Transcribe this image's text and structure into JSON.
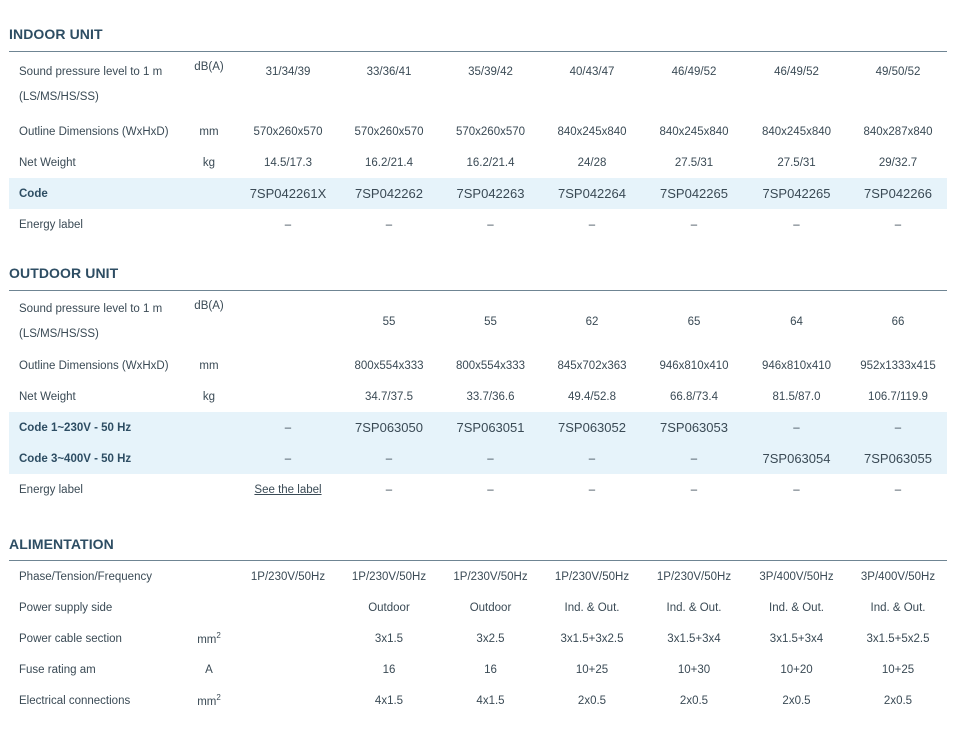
{
  "indoor": {
    "title": "INDOOR UNIT",
    "rows": [
      {
        "label_line1": "Sound pressure level to 1 m",
        "label_line2": "(LS/MS/HS/SS)",
        "unit": "dB(A)",
        "values": [
          "31/34/39",
          "33/36/41",
          "35/39/42",
          "40/43/47",
          "46/49/52",
          "46/49/52",
          "49/50/52"
        ]
      },
      {
        "label": "Outline Dimensions (WxHxD)",
        "unit": "mm",
        "values": [
          "570x260x570",
          "570x260x570",
          "570x260x570",
          "840x245x840",
          "840x245x840",
          "840x245x840",
          "840x287x840"
        ]
      },
      {
        "label": "Net Weight",
        "unit": "kg",
        "values": [
          "14.5/17.3",
          "16.2/21.4",
          "16.2/21.4",
          "24/28",
          "27.5/31",
          "27.5/31",
          "29/32.7"
        ]
      },
      {
        "label": "Code",
        "unit": "",
        "values": [
          "7SP042261X",
          "7SP042262",
          "7SP042263",
          "7SP042264",
          "7SP042265",
          "7SP042265",
          "7SP042266"
        ]
      },
      {
        "label": "Energy label",
        "unit": "",
        "values": [
          "–",
          "–",
          "–",
          "–",
          "–",
          "–",
          "–"
        ]
      }
    ]
  },
  "outdoor": {
    "title": "OUTDOOR UNIT",
    "rows": [
      {
        "label_line1": "Sound pressure level to 1 m",
        "label_line2": "(LS/MS/HS/SS)",
        "unit": "dB(A)",
        "values": [
          "",
          "55",
          "55",
          "62",
          "65",
          "64",
          "66"
        ]
      },
      {
        "label": "Outline Dimensions (WxHxD)",
        "unit": "mm",
        "values": [
          "",
          "800x554x333",
          "800x554x333",
          "845x702x363",
          "946x810x410",
          "946x810x410",
          "952x1333x415"
        ]
      },
      {
        "label": "Net Weight",
        "unit": "kg",
        "values": [
          "",
          "34.7/37.5",
          "33.7/36.6",
          "49.4/52.8",
          "66.8/73.4",
          "81.5/87.0",
          "106.7/119.9"
        ]
      },
      {
        "label": "Code 1~230V - 50 Hz",
        "unit": "",
        "values": [
          "–",
          "7SP063050",
          "7SP063051",
          "7SP063052",
          "7SP063053",
          "–",
          "–"
        ]
      },
      {
        "label": "Code 3~400V - 50 Hz",
        "unit": "",
        "values": [
          "–",
          "–",
          "–",
          "–",
          "–",
          "7SP063054",
          "7SP063055"
        ]
      },
      {
        "label": "Energy label",
        "unit": "",
        "values": [
          "See the label",
          "–",
          "–",
          "–",
          "–",
          "–",
          "–"
        ]
      }
    ]
  },
  "alimentation": {
    "title": "ALIMENTATION",
    "rows": [
      {
        "label": "Phase/Tension/Frequency",
        "unit": "",
        "values": [
          "1P/230V/50Hz",
          "1P/230V/50Hz",
          "1P/230V/50Hz",
          "1P/230V/50Hz",
          "1P/230V/50Hz",
          "3P/400V/50Hz",
          "3P/400V/50Hz"
        ]
      },
      {
        "label": "Power supply side",
        "unit": "",
        "values": [
          "",
          "Outdoor",
          "Outdoor",
          "Ind. & Out.",
          "Ind. & Out.",
          "Ind. & Out.",
          "Ind. & Out."
        ]
      },
      {
        "label": "Power cable section",
        "unit_base": "mm",
        "unit_sup": "2",
        "values": [
          "",
          "3x1.5",
          "3x2.5",
          "3x1.5+3x2.5",
          "3x1.5+3x4",
          "3x1.5+3x4",
          "3x1.5+5x2.5"
        ]
      },
      {
        "label": "Fuse rating am",
        "unit": "A",
        "values": [
          "",
          "16",
          "16",
          "10+25",
          "10+30",
          "10+20",
          "10+25"
        ]
      },
      {
        "label": "Electrical connections",
        "unit_base": "mm",
        "unit_sup": "2",
        "values": [
          "",
          "4x1.5",
          "4x1.5",
          "2x0.5",
          "2x0.5",
          "2x0.5",
          "2x0.5"
        ]
      }
    ]
  }
}
